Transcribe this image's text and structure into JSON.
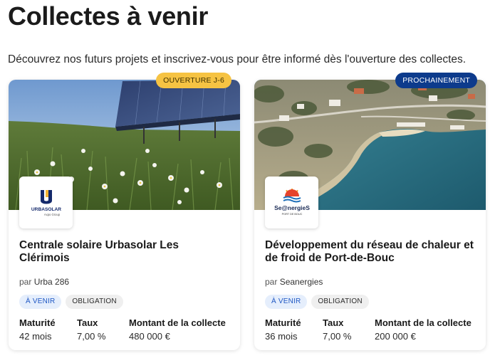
{
  "page": {
    "title": "Collectes à venir",
    "intro": "Découvrez nos futurs projets et inscrivez-vous pour être informé dès l'ouverture des collectes."
  },
  "colors": {
    "badge_soon_bg": "#f6c343",
    "badge_upcoming_bg": "#0d3b8c",
    "status_tag_text": "#1f57c3"
  },
  "projects": [
    {
      "badge": "OUVERTURE J-6",
      "image_icon": "solar-panels-field-image",
      "logo_icon": "urbasolar-logo",
      "logo_text": "URBASOLAR",
      "logo_subtext": "Axpo Group",
      "title": "Centrale solaire Urbasolar Les Clérimois",
      "author_prefix": "par",
      "author": "Urba 286",
      "status_tag": "À VENIR",
      "type_tag": "OBLIGATION",
      "stats": [
        {
          "label": "Maturité",
          "value": "42 mois"
        },
        {
          "label": "Taux",
          "value": "7,00 %"
        },
        {
          "label": "Montant de la collecte",
          "value": "480 000 €"
        }
      ]
    },
    {
      "badge": "PROCHAINEMENT",
      "image_icon": "coastline-aerial-image",
      "logo_icon": "seanergies-logo",
      "logo_text": "Se@nergieS",
      "logo_subtext": "PORT DE BOUC",
      "title": "Développement du réseau de chaleur et de froid de Port-de-Bouc",
      "author_prefix": "par",
      "author": "Seanergies",
      "status_tag": "À VENIR",
      "type_tag": "OBLIGATION",
      "stats": [
        {
          "label": "Maturité",
          "value": "36 mois"
        },
        {
          "label": "Taux",
          "value": "7,00 %"
        },
        {
          "label": "Montant de la collecte",
          "value": "200 000 €"
        }
      ]
    }
  ]
}
